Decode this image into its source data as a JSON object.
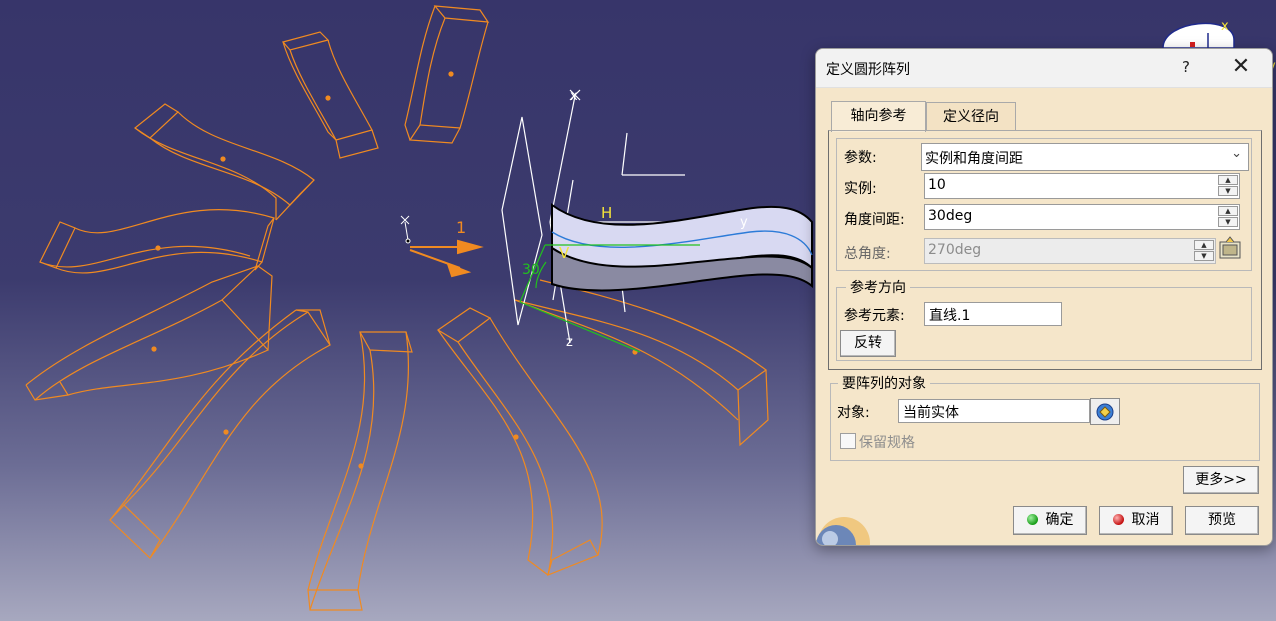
{
  "viewport": {
    "background_top": "#37356a",
    "background_bottom": "#a7a8bf",
    "labels": {
      "x_top": "x",
      "y_right": "y",
      "z_bottom": "z",
      "h": "H",
      "v": "V",
      "num_one": "1",
      "angle": "30",
      "compass_x": "x",
      "compass_y": "y"
    },
    "colors": {
      "wireframe": "#f08a21",
      "axis": "#ffffff",
      "green_guide": "#22c11e",
      "selected_surface": "#d8d9f2"
    }
  },
  "dialog": {
    "title": "定义圆形阵列",
    "help_label": "?",
    "close_label": "✕",
    "tabs": [
      {
        "label": "轴向参考",
        "active": true
      },
      {
        "label": "定义径向",
        "active": false
      }
    ],
    "params": {
      "parameter_label": "参数:",
      "parameter_value": "实例和角度间距",
      "instances_label": "实例:",
      "instances_value": "10",
      "angular_spacing_label": "角度间距:",
      "angular_spacing_value": "30deg",
      "total_angle_label": "总角度:",
      "total_angle_value": "270deg"
    },
    "reference_direction": {
      "group_title": "参考方向",
      "ref_element_label": "参考元素:",
      "ref_element_value": "直线.1",
      "reverse_button": "反转"
    },
    "objects": {
      "group_title": "要阵列的对象",
      "object_label": "对象:",
      "object_value": "当前实体",
      "keep_spec_label": "保留规格",
      "keep_spec_checked": false
    },
    "buttons": {
      "more": "更多>>",
      "ok": "确定",
      "cancel": "取消",
      "preview": "预览"
    }
  }
}
